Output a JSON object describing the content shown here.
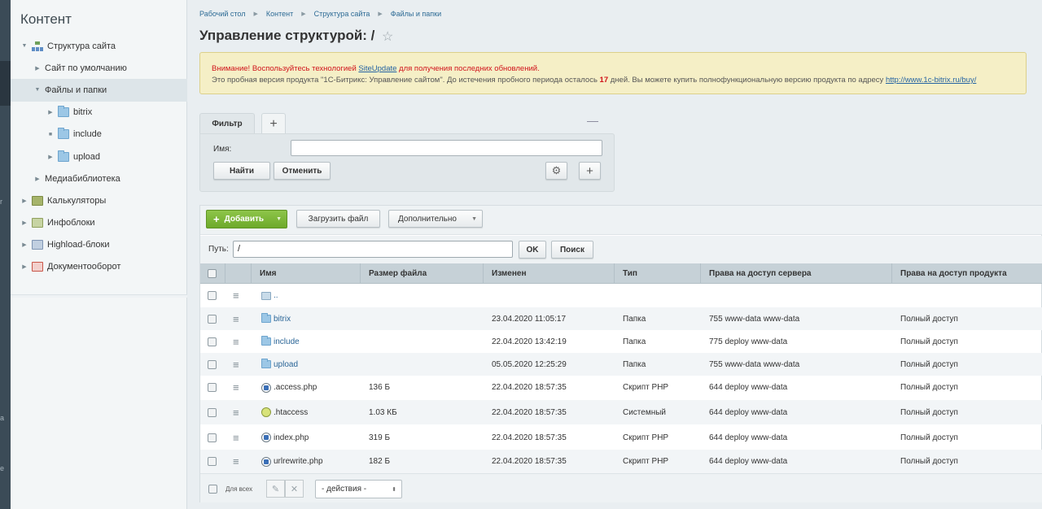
{
  "leftbar": {
    "letters": [
      "r",
      "a",
      "e"
    ]
  },
  "sidebar": {
    "title": "Контент",
    "items": [
      {
        "label": "Структура сайта",
        "level": 0,
        "arrow": "▼",
        "icon": "site-structure-icon",
        "active": false
      },
      {
        "label": "Сайт по умолчанию",
        "level": 1,
        "arrow": "▶",
        "icon": "",
        "active": false
      },
      {
        "label": "Файлы и папки",
        "level": 1,
        "arrow": "▼",
        "icon": "",
        "active": true
      },
      {
        "label": "bitrix",
        "level": 2,
        "arrow": "▶",
        "icon": "folder-icon",
        "active": false
      },
      {
        "label": "include",
        "level": 2,
        "arrow": "■",
        "icon": "folder-icon",
        "active": false
      },
      {
        "label": "upload",
        "level": 2,
        "arrow": "▶",
        "icon": "folder-icon",
        "active": false
      },
      {
        "label": "Медиабиблиотека",
        "level": 1,
        "arrow": "▶",
        "icon": "",
        "active": false
      },
      {
        "label": "Калькуляторы",
        "level": 0,
        "arrow": "▶",
        "icon": "calculator-icon",
        "active": false
      },
      {
        "label": "Инфоблоки",
        "level": 0,
        "arrow": "▶",
        "icon": "iblock-icon",
        "active": false
      },
      {
        "label": "Highload-блоки",
        "level": 0,
        "arrow": "▶",
        "icon": "highload-icon",
        "active": false
      },
      {
        "label": "Документооборот",
        "level": 0,
        "arrow": "▶",
        "icon": "document-flow-icon",
        "active": false
      }
    ]
  },
  "breadcrumb": [
    "Рабочий стол",
    "Контент",
    "Структура сайта",
    "Файлы и папки"
  ],
  "breadcrumb_sep": "▶",
  "page": {
    "title": "Управление структурой: /",
    "star": "☆"
  },
  "notice": {
    "warn_prefix": "Внимание! Воспользуйтесь технологией ",
    "warn_link": "SiteUpdate",
    "warn_suffix": " для получения последних обновлений.",
    "trial_text_1": "Это пробная версия продукта \"1С-Битрикс: Управление сайтом\". До истечения пробного периода осталось ",
    "trial_days": "17",
    "trial_text_2": " дней. Вы можете купить полнофункциональную версию продукта по адресу ",
    "trial_link": "http://www.1c-bitrix.ru/buy/"
  },
  "filter": {
    "tab_label": "Фильтр",
    "add_tab": "+",
    "minimize": "—",
    "name_label": "Имя:",
    "name_value": "",
    "find": "Найти",
    "cancel": "Отменить",
    "gear": "⚙",
    "plus": "+"
  },
  "toolbar": {
    "add": "Добавить",
    "add_plus": "+",
    "upload": "Загрузить файл",
    "more": "Дополнительно",
    "caret": "▼"
  },
  "pathbar": {
    "label": "Путь:",
    "value": "/",
    "ok": "OK",
    "search": "Поиск"
  },
  "columns": [
    "Имя",
    "Размер файла",
    "Изменен",
    "Тип",
    "Права на доступ сервера",
    "Права на доступ продукта"
  ],
  "rows": [
    {
      "name": "..",
      "icon": "up-folder-icon",
      "size": "",
      "modified": "",
      "type": "",
      "server": "",
      "product": ""
    },
    {
      "name": "bitrix",
      "icon": "folder-icon",
      "size": "",
      "modified": "23.04.2020 11:05:17",
      "type": "Папка",
      "server": "755 www-data www-data",
      "product": "Полный доступ"
    },
    {
      "name": "include",
      "icon": "folder-icon",
      "size": "",
      "modified": "22.04.2020 13:42:19",
      "type": "Папка",
      "server": "775 deploy www-data",
      "product": "Полный доступ"
    },
    {
      "name": "upload",
      "icon": "folder-icon",
      "size": "",
      "modified": "05.05.2020 12:25:29",
      "type": "Папка",
      "server": "755 www-data www-data",
      "product": "Полный доступ"
    },
    {
      "name": ".access.php",
      "icon": "php-file-icon",
      "size": "136 Б",
      "modified": "22.04.2020 18:57:35",
      "type": "Скрипт PHP",
      "server": "644 deploy www-data",
      "product": "Полный доступ"
    },
    {
      "name": ".htaccess",
      "icon": "system-file-icon",
      "size": "1.03 КБ",
      "modified": "22.04.2020 18:57:35",
      "type": "Системный",
      "server": "644 deploy www-data",
      "product": "Полный доступ"
    },
    {
      "name": "index.php",
      "icon": "php-file-icon",
      "size": "319 Б",
      "modified": "22.04.2020 18:57:35",
      "type": "Скрипт PHP",
      "server": "644 deploy www-data",
      "product": "Полный доступ"
    },
    {
      "name": "urlrewrite.php",
      "icon": "php-file-icon",
      "size": "182 Б",
      "modified": "22.04.2020 18:57:35",
      "type": "Скрипт PHP",
      "server": "644 deploy www-data",
      "product": "Полный доступ"
    }
  ],
  "footer": {
    "for_all": "Для всех",
    "edit": "✎",
    "delete": "✕",
    "actions": "- действия -",
    "actions_caret": "⬍"
  },
  "colors": {
    "accent": "#6da92a",
    "link": "#2a6597",
    "warning": "#d0131a"
  }
}
